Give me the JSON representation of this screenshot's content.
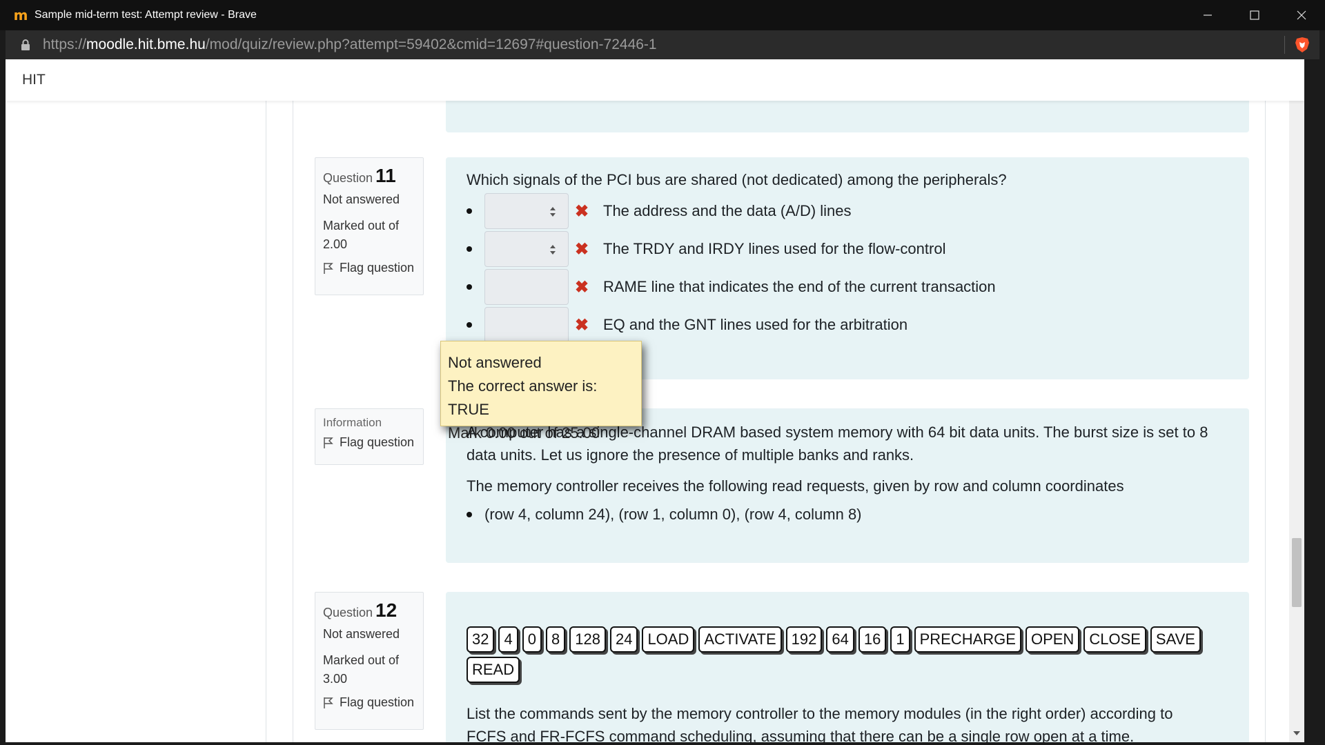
{
  "window": {
    "title": "Sample mid-term test: Attempt review - Brave"
  },
  "address_bar": {
    "scheme": "https://",
    "host": "moodle.hit.bme.hu",
    "path": "/mod/quiz/review.php?attempt=59402&cmid=12697#question-72446-1"
  },
  "site": {
    "name": "HIT"
  },
  "question11": {
    "label": "Question",
    "number": "11",
    "state": "Not answered",
    "grade_line1": "Marked out of",
    "grade_line2": "2.00",
    "flag": "Flag question",
    "text": "Which signals of the PCI bus are shared (not dedicated) among the peripherals?",
    "answers": [
      "The address and the data (A/D) lines",
      "The TRDY and IRDY lines used for the flow-control",
      "RAME line that indicates the end of the current transaction",
      "EQ and the GNT lines used for the arbitration"
    ]
  },
  "tooltip": {
    "line1": "Not answered",
    "line2": "The correct answer is: TRUE",
    "line3": "Mark 0.00 out of 25.00"
  },
  "information": {
    "label": "Information",
    "flag": "Flag question",
    "p1": "A computer has a single-channel DRAM based system memory with 64 bit data units. The burst size is set to 8 data units. Let us ignore the presence of multiple banks and ranks.",
    "p2": "The memory controller receives the following read requests, given by row and column coordinates",
    "bullet": "(row 4, column 24), (row 1, column 0), (row 4, column 8)"
  },
  "question12": {
    "label": "Question",
    "number": "12",
    "state": "Not answered",
    "grade_line1": "Marked out of",
    "grade_line2": "3.00",
    "flag": "Flag question",
    "chips": [
      "32",
      "4",
      "0",
      "8",
      "128",
      "24",
      "LOAD",
      "ACTIVATE",
      "192",
      "64",
      "16",
      "1",
      "PRECHARGE",
      "OPEN",
      "CLOSE",
      "SAVE",
      "READ"
    ],
    "text": "List the commands sent by the memory controller to the memory modules (in the right order) according to",
    "text2": "FCFS and FR-FCFS command scheduling, assuming that there can be a single row open at a time."
  },
  "colors": {
    "content_bg": "#e7f3f5",
    "tooltip_bg": "#fdf2c2",
    "incorrect": "#ca3120"
  }
}
